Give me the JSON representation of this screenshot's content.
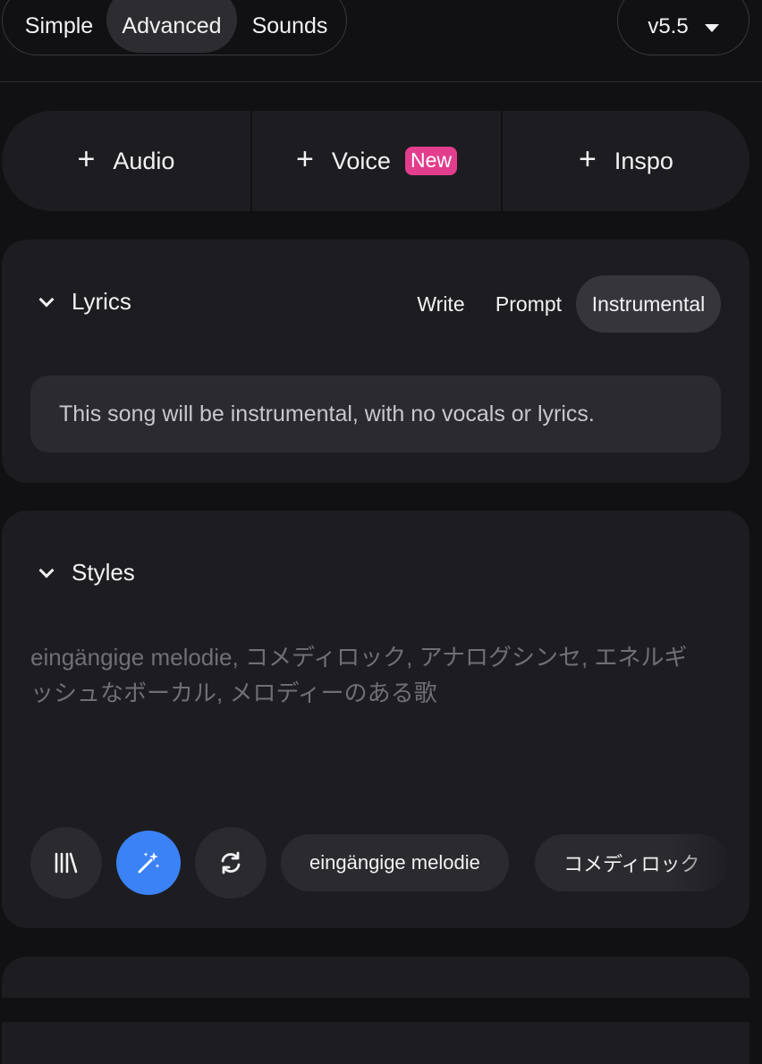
{
  "modes": {
    "items": [
      "Simple",
      "Advanced",
      "Sounds"
    ],
    "active": "Advanced"
  },
  "version": {
    "label": "v5.5",
    "icon": "caret-down-icon"
  },
  "add_row": {
    "audio": "Audio",
    "voice": "Voice",
    "voice_badge": "New",
    "inspo": "Inspo",
    "badge_color": "#e33d8d"
  },
  "lyrics": {
    "title": "Lyrics",
    "tabs": [
      "Write",
      "Prompt",
      "Instrumental"
    ],
    "active_tab": "Instrumental",
    "message": "This song will be instrumental, with no vocals or lyrics."
  },
  "styles": {
    "title": "Styles",
    "placeholder_line1": "eingängige melodie, コメディロック, アナログシンセ, エネルギ",
    "placeholder_line2": "ッシュなボーカル, メロディーのある歌",
    "chips": [
      "eingängige melodie",
      "コメディロック"
    ],
    "accent": "#3b82f6"
  }
}
